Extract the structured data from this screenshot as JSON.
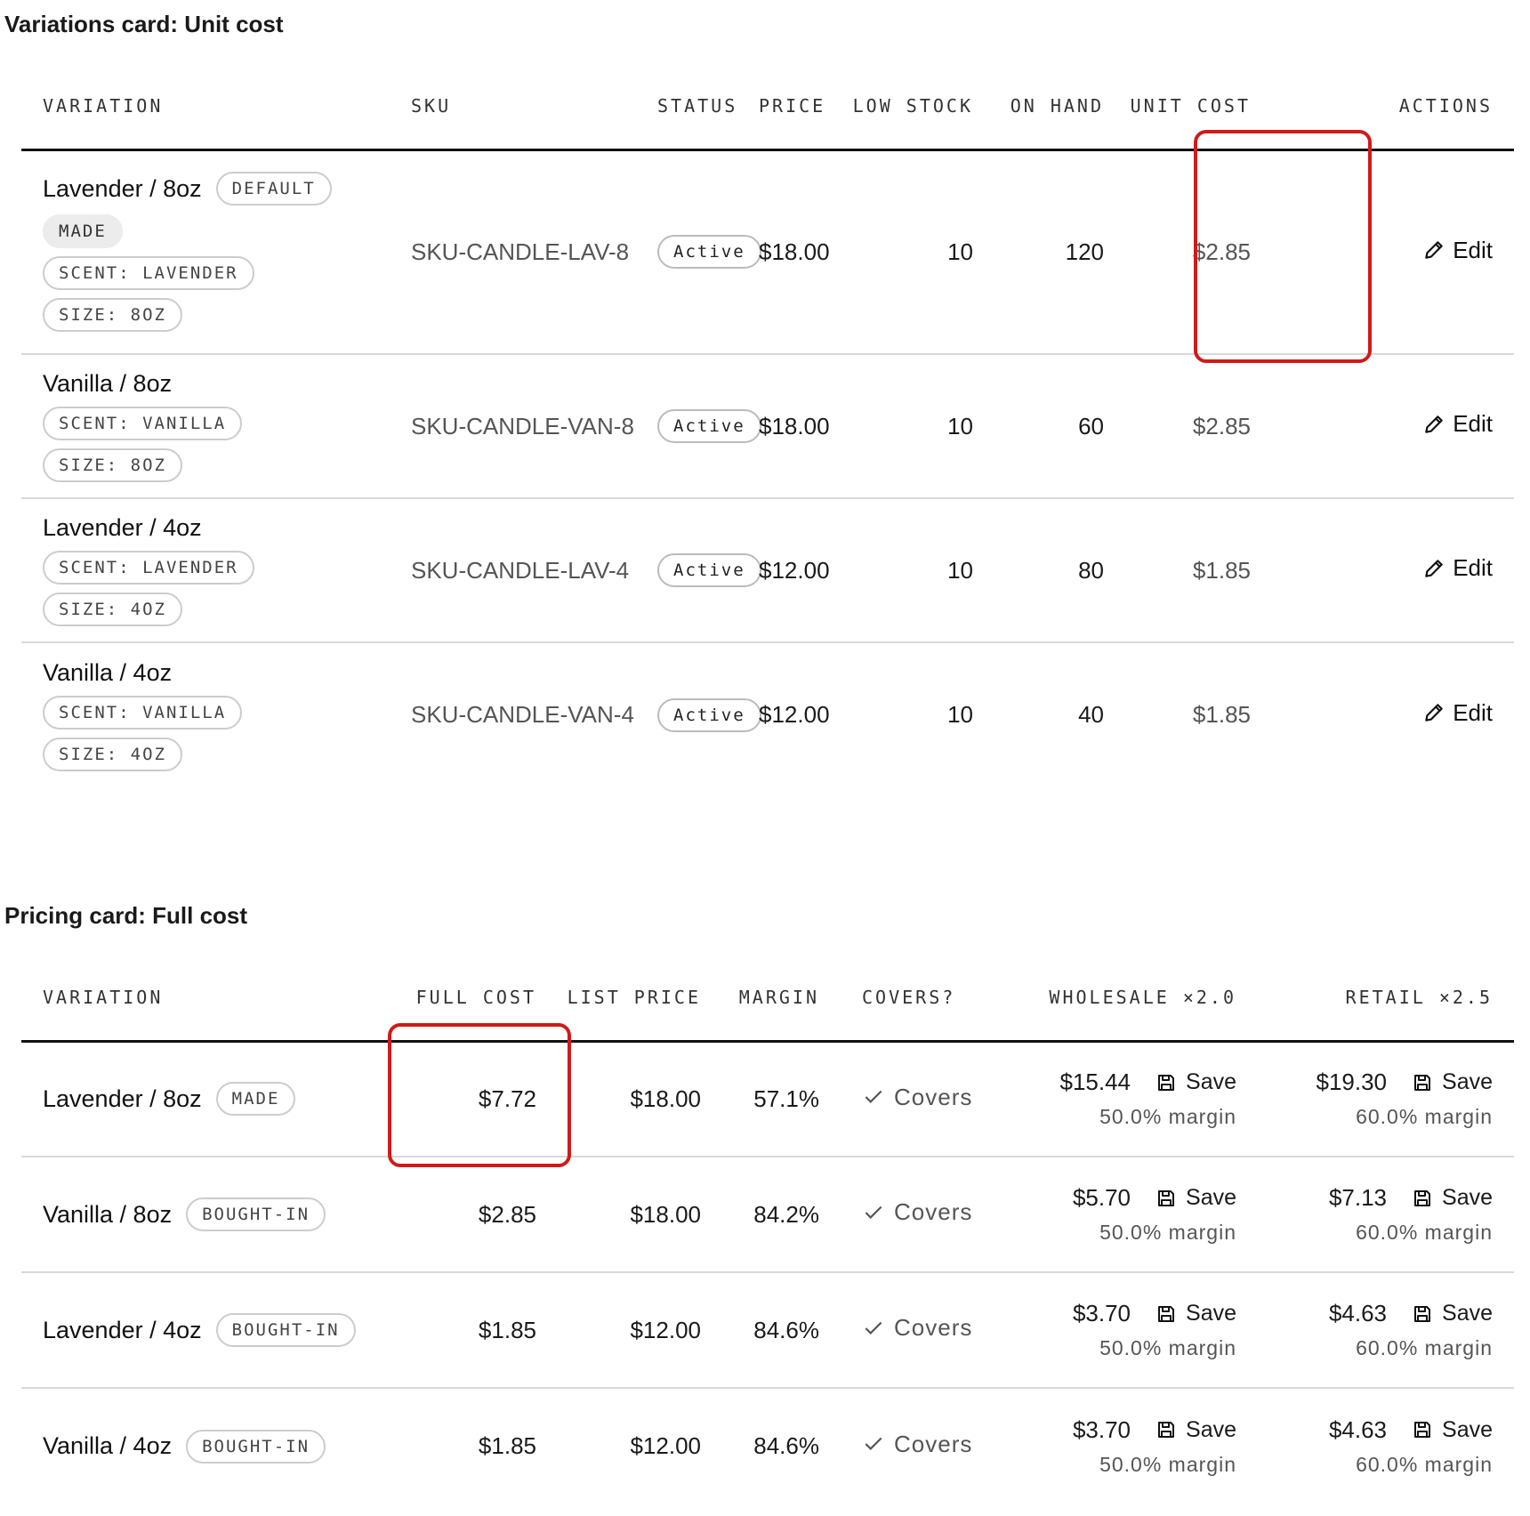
{
  "variations": {
    "title": "Variations card: Unit cost",
    "headers": {
      "variation": "VARIATION",
      "sku": "SKU",
      "status": "STATUS",
      "price": "PRICE",
      "low_stock": "LOW STOCK",
      "on_hand": "ON HAND",
      "unit_cost": "UNIT COST",
      "actions": "ACTIONS"
    },
    "rows": [
      {
        "name": "Lavender / 8oz",
        "default_badge": "DEFAULT",
        "source": "MADE",
        "scent": "SCENT: LAVENDER",
        "size": "SIZE: 8OZ",
        "sku": "SKU-CANDLE-LAV-8",
        "status": "Active",
        "price": "$18.00",
        "low_stock": "10",
        "on_hand": "120",
        "unit_cost": "$2.85",
        "action": "Edit"
      },
      {
        "name": "Vanilla / 8oz",
        "scent": "SCENT: VANILLA",
        "size": "SIZE: 8OZ",
        "sku": "SKU-CANDLE-VAN-8",
        "status": "Active",
        "price": "$18.00",
        "low_stock": "10",
        "on_hand": "60",
        "unit_cost": "$2.85",
        "action": "Edit"
      },
      {
        "name": "Lavender / 4oz",
        "scent": "SCENT: LAVENDER",
        "size": "SIZE: 4OZ",
        "sku": "SKU-CANDLE-LAV-4",
        "status": "Active",
        "price": "$12.00",
        "low_stock": "10",
        "on_hand": "80",
        "unit_cost": "$1.85",
        "action": "Edit"
      },
      {
        "name": "Vanilla / 4oz",
        "scent": "SCENT: VANILLA",
        "size": "SIZE: 4OZ",
        "sku": "SKU-CANDLE-VAN-4",
        "status": "Active",
        "price": "$12.00",
        "low_stock": "10",
        "on_hand": "40",
        "unit_cost": "$1.85",
        "action": "Edit"
      }
    ]
  },
  "pricing": {
    "title": "Pricing card: Full cost",
    "headers": {
      "variation": "VARIATION",
      "full_cost": "FULL COST",
      "list_price": "LIST PRICE",
      "margin": "MARGIN",
      "covers": "COVERS?",
      "wholesale": "WHOLESALE",
      "wholesale_mult": "×2.0",
      "retail": "RETAIL",
      "retail_mult": "×2.5"
    },
    "rows": [
      {
        "name": "Lavender / 8oz",
        "source": "MADE",
        "full_cost": "$7.72",
        "list_price": "$18.00",
        "margin": "57.1%",
        "covers": "Covers",
        "wholesale_price": "$15.44",
        "wholesale_save": "Save",
        "wholesale_margin": "50.0% margin",
        "retail_price": "$19.30",
        "retail_save": "Save",
        "retail_margin": "60.0% margin"
      },
      {
        "name": "Vanilla / 8oz",
        "source": "BOUGHT-IN",
        "full_cost": "$2.85",
        "list_price": "$18.00",
        "margin": "84.2%",
        "covers": "Covers",
        "wholesale_price": "$5.70",
        "wholesale_save": "Save",
        "wholesale_margin": "50.0% margin",
        "retail_price": "$7.13",
        "retail_save": "Save",
        "retail_margin": "60.0% margin"
      },
      {
        "name": "Lavender / 4oz",
        "source": "BOUGHT-IN",
        "full_cost": "$1.85",
        "list_price": "$12.00",
        "margin": "84.6%",
        "covers": "Covers",
        "wholesale_price": "$3.70",
        "wholesale_save": "Save",
        "wholesale_margin": "50.0% margin",
        "retail_price": "$4.63",
        "retail_save": "Save",
        "retail_margin": "60.0% margin"
      },
      {
        "name": "Vanilla / 4oz",
        "source": "BOUGHT-IN",
        "full_cost": "$1.85",
        "list_price": "$12.00",
        "margin": "84.6%",
        "covers": "Covers",
        "wholesale_price": "$3.70",
        "wholesale_save": "Save",
        "wholesale_margin": "50.0% margin",
        "retail_price": "$4.63",
        "retail_save": "Save",
        "retail_margin": "60.0% margin"
      }
    ]
  },
  "colors": {
    "highlight": "#d11a1a",
    "rule": "#111111",
    "divider": "#d9d9d9"
  },
  "icons": {
    "edit": "pencil-icon",
    "covers": "check-icon",
    "save": "floppy-disk-icon"
  }
}
